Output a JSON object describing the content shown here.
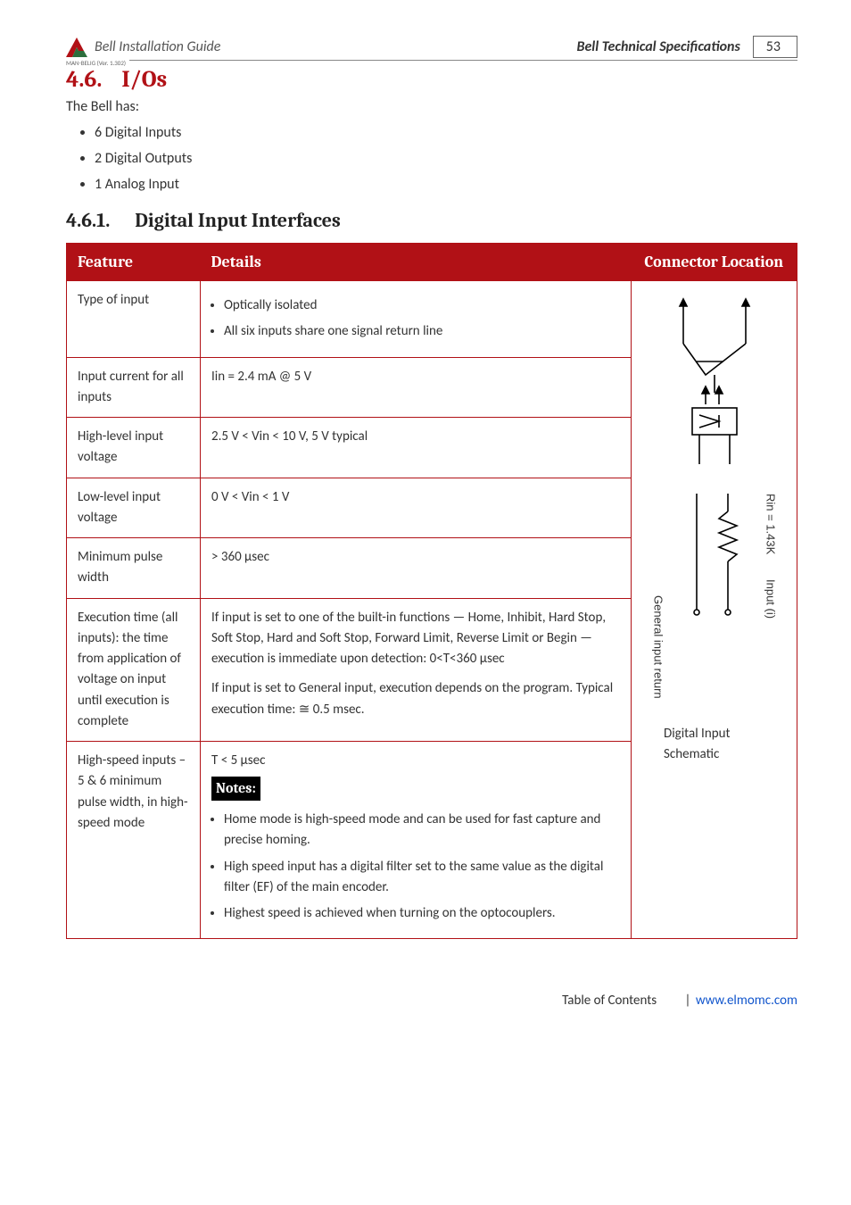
{
  "header": {
    "guide_title": "Bell Installation Guide",
    "spec_title": "Bell Technical Specifications",
    "page_number": "53",
    "man_label": "MAN-BELIG (Ver. 1.302)"
  },
  "section": {
    "number": "4.6.",
    "title": "I/Os",
    "intro": "The Bell has:",
    "bullets": [
      "6 Digital Inputs",
      "2 Digital Outputs",
      "1 Analog Input"
    ]
  },
  "subsection": {
    "number": "4.6.1.",
    "title": "Digital Input Interfaces"
  },
  "table": {
    "headers": {
      "feature": "Feature",
      "details": "Details",
      "connector": "Connector Location"
    },
    "rows": [
      {
        "feature": "Type of input",
        "details_list": [
          "Optically isolated",
          "All six inputs share one signal return line"
        ]
      },
      {
        "feature": "Input current for all inputs",
        "details_text": "Iin = 2.4 mA @ 5 V"
      },
      {
        "feature": "High-level input voltage",
        "details_text": "2.5 V < Vin < 10 V, 5 V typical"
      },
      {
        "feature": "Low-level input voltage",
        "details_text": "0 V < Vin < 1 V"
      },
      {
        "feature": "Minimum pulse width",
        "details_text": "> 360 µsec"
      },
      {
        "feature": "Execution time (all inputs): the time from application of voltage on input until execution is complete",
        "details_paras": [
          "If input is set to one of the built-in functions — Home, Inhibit, Hard Stop, Soft Stop, Hard and Soft Stop, Forward Limit, Reverse Limit or Begin — execution is immediate upon detection: 0<T<360 µsec",
          "If input is set to General input, execution depends on the program. Typical execution time: ≅ 0.5 msec."
        ]
      },
      {
        "feature": "High-speed inputs – 5 & 6 minimum pulse width, in high-speed mode",
        "hs_top": "T < 5 µsec",
        "notes_label": "Notes:",
        "hs_notes": [
          "Home mode is high-speed mode and can be used for fast capture and precise homing.",
          "High speed input has a digital filter set to the same value as the digital filter (EF) of the main encoder.",
          "Highest speed is achieved when turning on the optocouplers."
        ]
      }
    ],
    "schematic": {
      "rin_label": "Rin = 1.43K",
      "input_label": "Input (i)",
      "return_label": "General input return",
      "caption": "Digital Input Schematic"
    }
  },
  "footer": {
    "toc": "Table of Contents",
    "url_text": "www.elmomc.com"
  }
}
